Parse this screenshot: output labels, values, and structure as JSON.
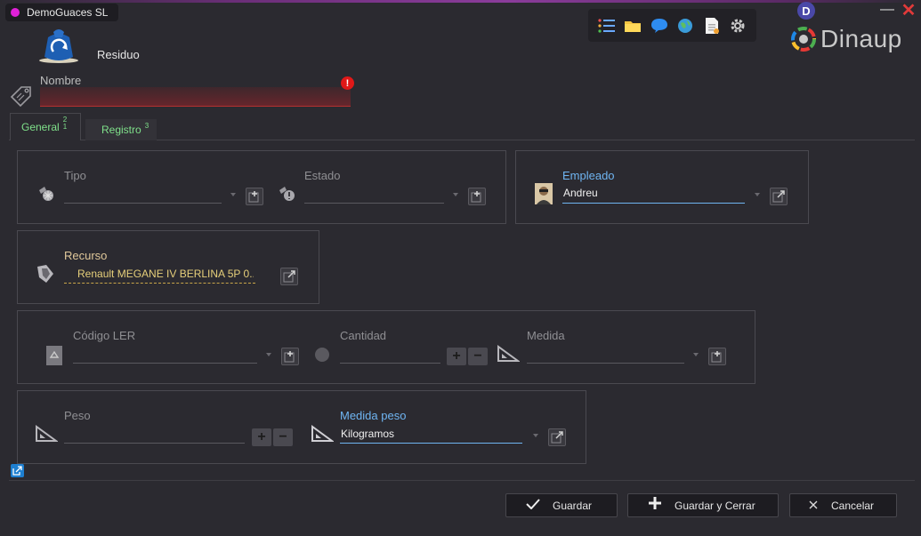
{
  "app": {
    "name": "DemoGuaces SL",
    "brand": "Dinaup",
    "user_initial": "D"
  },
  "module": {
    "title": "Residuo"
  },
  "nombre": {
    "label": "Nombre",
    "value": "",
    "error_mark": "!"
  },
  "tabs": [
    {
      "label": "General",
      "count_top": "2",
      "count_bottom": "1"
    },
    {
      "label": "Registro",
      "count_top": "3"
    }
  ],
  "fields": {
    "tipo": {
      "label": "Tipo",
      "value": ""
    },
    "estado": {
      "label": "Estado",
      "value": ""
    },
    "empleado": {
      "label": "Empleado",
      "value": "Andreu"
    },
    "recurso": {
      "label": "Recurso",
      "value": "Renault MEGANE IV BERLINA 5P  0..."
    },
    "codigo_ler": {
      "label": "Código LER",
      "value": ""
    },
    "cantidad": {
      "label": "Cantidad",
      "value": ""
    },
    "medida": {
      "label": "Medida",
      "value": ""
    },
    "peso": {
      "label": "Peso",
      "value": ""
    },
    "medida_peso": {
      "label": "Medida peso",
      "value": "Kilogramos"
    }
  },
  "actions": {
    "guardar": "Guardar",
    "guardar_cerrar": "Guardar y Cerrar",
    "cancelar": "Cancelar"
  },
  "stepper": {
    "plus": "+",
    "minus": "−"
  },
  "icons": {
    "toolbar": [
      "list-icon",
      "folder-icon",
      "chat-icon",
      "globe-icon",
      "document-icon",
      "gear-icon"
    ],
    "close": "✕",
    "minimize": "—"
  },
  "colors": {
    "accent_blue": "#6fb5f2",
    "tab_green": "#7fe08a",
    "error_red": "#e01818",
    "resource_gold": "#e6cf7a"
  }
}
